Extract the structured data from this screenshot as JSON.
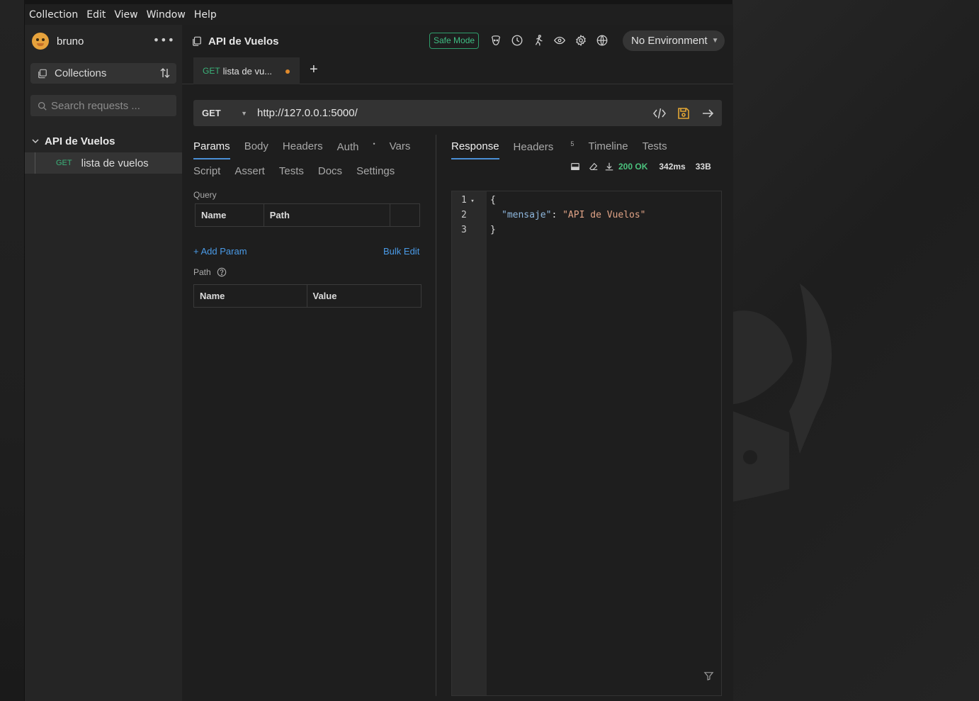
{
  "menu": [
    "Collection",
    "Edit",
    "View",
    "Window",
    "Help"
  ],
  "sidebar": {
    "workspace": "bruno",
    "collections_label": "Collections",
    "search_placeholder": "Search requests ...",
    "collection_name": "API de Vuelos",
    "requests": [
      {
        "method": "GET",
        "name": "lista de vuelos"
      }
    ]
  },
  "header": {
    "collection_title": "API de Vuelos",
    "safe_mode": "Safe Mode",
    "environment": "No Environment",
    "icons": [
      "bruno-icon",
      "history-icon",
      "runner-icon",
      "eye-icon",
      "settings-icon",
      "globe-icon"
    ]
  },
  "tab": {
    "method": "GET",
    "title": "lista de vu...",
    "unsaved": true
  },
  "request": {
    "method": "GET",
    "url": "http://127.0.0.1:5000/",
    "tabs_row1": [
      "Params",
      "Body",
      "Headers",
      "Auth",
      "Vars"
    ],
    "auth_marker": "•",
    "tabs_row2": [
      "Script",
      "Assert",
      "Tests",
      "Docs",
      "Settings"
    ],
    "query_label": "Query",
    "query_columns": [
      "Name",
      "Path"
    ],
    "add_param": "+ Add Param",
    "bulk_edit": "Bulk Edit",
    "path_label": "Path",
    "path_columns": [
      "Name",
      "Value"
    ]
  },
  "response": {
    "tabs": [
      "Response",
      "Headers",
      "Timeline",
      "Tests"
    ],
    "headers_count": "5",
    "status": "200 OK",
    "time": "342ms",
    "size": "33B",
    "lines": [
      "1",
      "2",
      "3"
    ],
    "json_open": "{",
    "json_key": "\"mensaje\"",
    "json_colon": ": ",
    "json_value": "\"API de Vuelos\"",
    "json_close": "}"
  },
  "colors": {
    "accent": "#4a8fd6",
    "get_method": "#3bb37a",
    "status_ok": "#4bc37e",
    "safe_mode": "#3fbf84"
  }
}
